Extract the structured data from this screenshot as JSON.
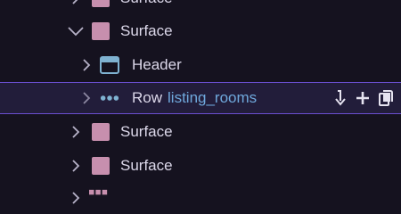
{
  "tree": {
    "items": [
      {
        "label": "Surface",
        "icon": "surface-icon",
        "chevron": "right"
      },
      {
        "label": "Surface",
        "icon": "surface-icon",
        "chevron": "down"
      },
      {
        "label": "Header",
        "icon": "header-icon",
        "chevron": "right"
      },
      {
        "label": "Row",
        "binding": "listing_rooms",
        "icon": "row-icon",
        "chevron": "right",
        "selected": true
      },
      {
        "label": "Surface",
        "icon": "surface-icon",
        "chevron": "right"
      },
      {
        "label": "Surface",
        "icon": "surface-icon",
        "chevron": "right"
      },
      {
        "label": "",
        "icon": "grid-icon",
        "chevron": "right"
      }
    ],
    "row_actions": [
      "move-down-icon",
      "add-icon",
      "copy-icon"
    ]
  },
  "colors": {
    "background": "#15121f",
    "selected_background": "#221d3a",
    "selected_border": "#6a4fd0",
    "surface": "#c78fae",
    "header": "#7fb2d1",
    "row": "#7fb2d1",
    "binding_text": "#6fa8dc"
  }
}
